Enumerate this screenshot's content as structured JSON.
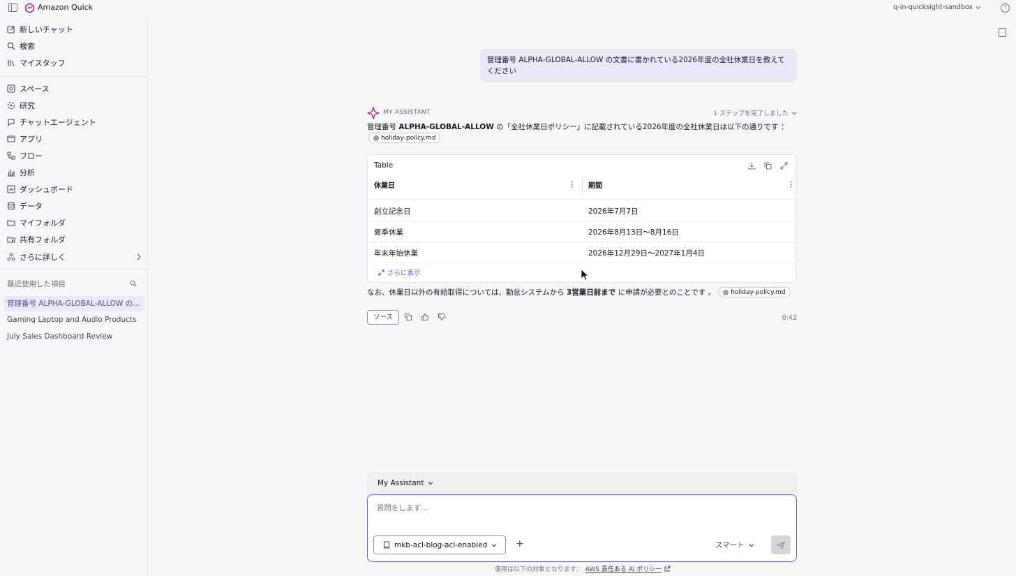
{
  "topbar": {
    "app_name": "Amazon Quick",
    "account": "q-in-quicksight-sandbox"
  },
  "sidebar": {
    "items": [
      {
        "label": "新しいチャット",
        "icon": "edit-icon"
      },
      {
        "label": "検索",
        "icon": "search-icon"
      },
      {
        "label": "マイスタッフ",
        "icon": "library-icon"
      },
      {
        "label": "スペース",
        "icon": "space-icon"
      },
      {
        "label": "研究",
        "icon": "research-icon"
      },
      {
        "label": "チャットエージェント",
        "icon": "chat-agent-icon"
      },
      {
        "label": "アプリ",
        "icon": "app-icon"
      },
      {
        "label": "フロー",
        "icon": "flow-icon"
      },
      {
        "label": "分析",
        "icon": "analysis-icon"
      },
      {
        "label": "ダッシュボード",
        "icon": "dashboard-icon"
      },
      {
        "label": "データ",
        "icon": "database-icon"
      },
      {
        "label": "マイフォルダ",
        "icon": "folder-icon"
      },
      {
        "label": "共有フォルダ",
        "icon": "shared-folder-icon"
      },
      {
        "label": "さらに詳しく",
        "icon": "more-icon"
      }
    ],
    "recent_header": "最近使用した項目",
    "recent": [
      "管理番号 ALPHA-GLOBAL-ALLOW の文書に書かれている2026年度の全社休業日を教えてください",
      "Gaming Laptop and Audio Products",
      "July Sales Dashboard Review"
    ]
  },
  "chat": {
    "user_message": "管理番号 ALPHA-GLOBAL-ALLOW の文書に書かれている2026年度の全社休業日を教えてください",
    "assistant_name": "MY ASSISTANT",
    "steps": "1 ステップを完了しました",
    "answer1_prefix": "管理番号 ",
    "answer1_bold": "ALPHA-GLOBAL-ALLOW",
    "answer1_suffix": " の「全社休業日ポリシー」に記載されている2026年度の全社休業日は以下の通りです ：",
    "source_chip": "holiday-policy.md",
    "table": {
      "title": "Table",
      "headers": [
        "休業日",
        "期間"
      ],
      "rows": [
        [
          "創立記念日",
          "2026年7月7日"
        ],
        [
          "夏季休業",
          "2026年8月13日〜8月16日"
        ],
        [
          "年末年始休業",
          "2026年12月29日〜2027年1月4日"
        ]
      ],
      "show_more": "さらに表示"
    },
    "answer2_prefix": "なお、休業日以外の有給取得については、勤怠システムから ",
    "answer2_bold": "3営業日前まで",
    "answer2_suffix": " に申請が必要とのことです 。",
    "source_button": "ソース",
    "elapsed": "0:42"
  },
  "composer": {
    "agent": "My Assistant",
    "placeholder": "質問をします...",
    "knowledge_base": "mkb-acl-blog-acl-enabled",
    "mode": "スマート"
  },
  "footer": {
    "text": "使用は以下の対象となります：",
    "link": "AWS 責任ある AI ポリシー"
  },
  "colors": {
    "accent": "#7a5bd6",
    "user_bubble": "#ebe8f6",
    "active_recent": "#ece8fb"
  }
}
